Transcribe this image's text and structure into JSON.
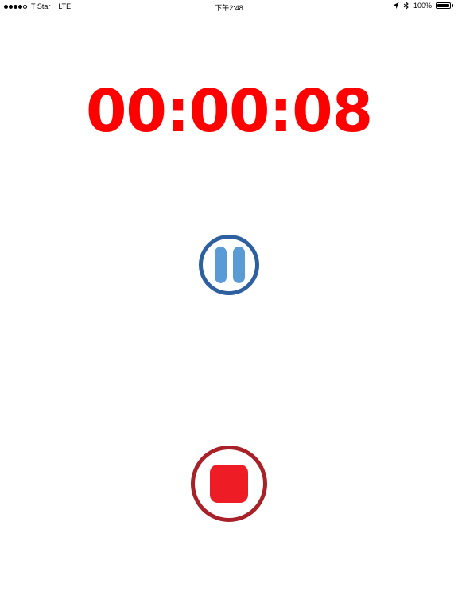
{
  "status_bar": {
    "carrier": "T Star",
    "network": "LTE",
    "time": "下午2:48",
    "battery_percent": "100%",
    "battery_level": 1.0,
    "signal_bars": 4,
    "signal_max": 5,
    "icons": [
      "location-arrow-icon",
      "bluetooth-icon",
      "battery-icon"
    ]
  },
  "timer": {
    "display": "00:00:08",
    "color": "#ff0000"
  },
  "controls": {
    "pause_icon": "pause-icon",
    "pause_color": "#2e5f9f",
    "stop_icon": "stop-icon",
    "stop_color": "#ee1c25"
  }
}
